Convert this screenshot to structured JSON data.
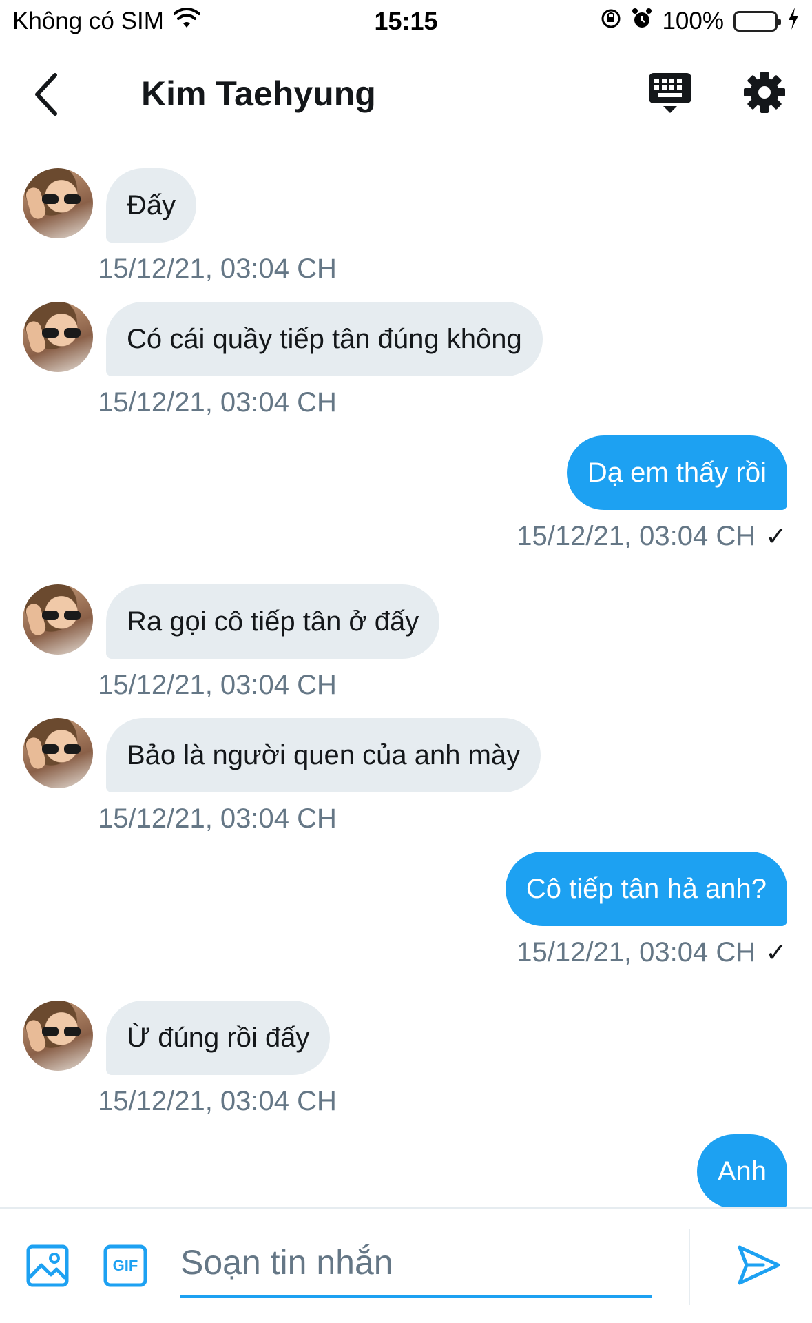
{
  "status_bar": {
    "carrier": "Không có SIM",
    "time": "15:15",
    "battery": "100%"
  },
  "header": {
    "title": "Kim Taehyung"
  },
  "messages": [
    {
      "direction": "in",
      "text": "Đấy",
      "timestamp": "15/12/21, 03:04 CH"
    },
    {
      "direction": "in",
      "text": "Có cái quầy tiếp tân đúng không",
      "timestamp": "15/12/21, 03:04 CH"
    },
    {
      "direction": "out",
      "text": "Dạ em thấy rồi",
      "timestamp": "15/12/21, 03:04 CH",
      "status": "✓"
    },
    {
      "direction": "in",
      "text": "Ra gọi cô tiếp tân ở đấy",
      "timestamp": "15/12/21, 03:04 CH"
    },
    {
      "direction": "in",
      "text": "Bảo là người quen của anh mày",
      "timestamp": "15/12/21, 03:04 CH"
    },
    {
      "direction": "out",
      "text": "Cô tiếp tân hả anh?",
      "timestamp": "15/12/21, 03:04 CH",
      "status": "✓"
    },
    {
      "direction": "in",
      "text": "Ừ đúng rồi đấy",
      "timestamp": "15/12/21, 03:04 CH"
    },
    {
      "direction": "out",
      "text": "Anh"
    }
  ],
  "composer": {
    "placeholder": "Soạn tin nhắn",
    "gif_label": "GIF"
  },
  "colors": {
    "accent": "#1da1f2",
    "incoming_bubble": "#e6ecf0",
    "timestamp": "#657786"
  }
}
